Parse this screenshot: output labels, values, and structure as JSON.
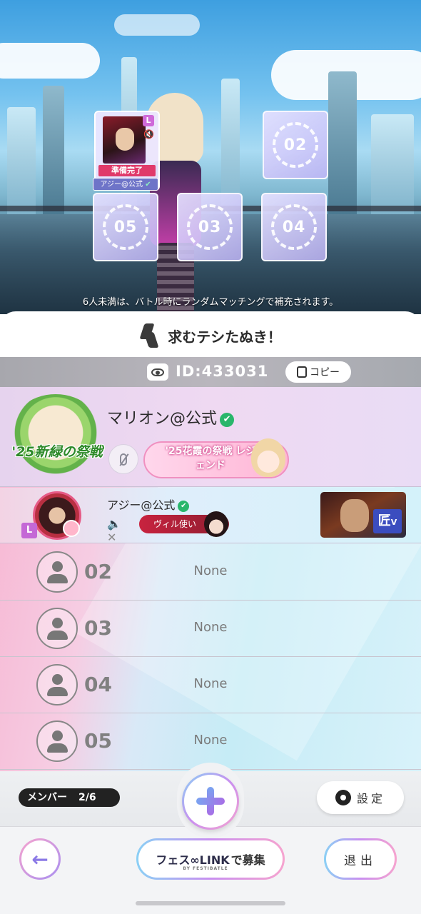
{
  "scene": {
    "notice": "6人未満は、バトル時にランダムマッチングで補充されます。",
    "filled_slot": {
      "level_badge": "L",
      "status": "準備完了",
      "player_name": "アジー@公式"
    },
    "empty_slots": [
      "02",
      "03",
      "05",
      "04"
    ]
  },
  "room": {
    "title": "求むテシたぬき！",
    "id_text": "ID:433031",
    "copy_label": "コピー"
  },
  "host": {
    "badge_text": "'25新緑の祭戦",
    "name": "マリオン@公式",
    "title_badge": "'25花霞の祭戦 レジェンド"
  },
  "member": {
    "level_badge": "L",
    "name": "アジー@公式",
    "tag": "ヴィル使い",
    "rank_label": "V"
  },
  "empty_members": [
    {
      "num": "02",
      "name": "None"
    },
    {
      "num": "03",
      "name": "None"
    },
    {
      "num": "04",
      "name": "None"
    },
    {
      "num": "05",
      "name": "None"
    }
  ],
  "footer": {
    "members_label": "メンバー",
    "members_count": "2/6",
    "settings_label": "設定",
    "recruit_logo": "フェス∞LINK",
    "recruit_sub": "BY FESTIBATLE",
    "recruit_suffix": "で募集",
    "exit_label": "退出"
  },
  "colors": {
    "accent_purple": "#a76fe6",
    "ready_red": "#e03a6a",
    "verified_green": "#29b66b"
  }
}
